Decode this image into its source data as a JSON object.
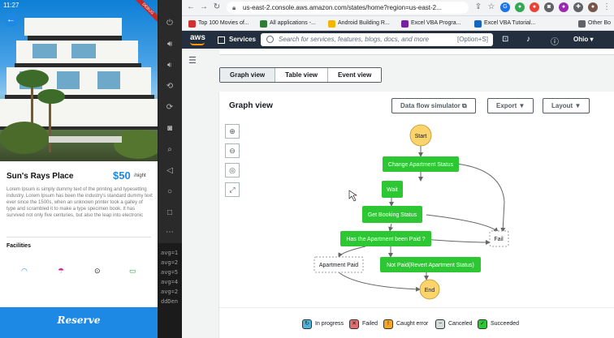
{
  "phone": {
    "status_time": "11:27",
    "debug_ribbon": "DEBUG",
    "place_title": "Sun's Rays Place",
    "price": "$50",
    "per_night": "/night",
    "description": "Lorem Ipsum is simply dummy text of the printing and typesetting industry. Lorem Ipsum has been the industry's standard dummy text ever since the 1500s, when an unknown printer took a galley of type and scrambled it to make a type specimen book. It has survived not only five centuries, but also the leap into electronic",
    "facilities_title": "Facilities",
    "facilities": [
      {
        "icon": "wifi-icon",
        "glyph": "◠",
        "color": "#1e88e5"
      },
      {
        "icon": "umbrella-icon",
        "glyph": "☂",
        "color": "#d81b9a"
      },
      {
        "icon": "bike-icon",
        "glyph": "⊙",
        "color": "#222222"
      },
      {
        "icon": "tv-icon",
        "glyph": "▭",
        "color": "#2e9e4f"
      }
    ],
    "reserve_label": "Reserve"
  },
  "console_lines": [
    "avg=1",
    "avg=2",
    "avg=5",
    "avg=4",
    "avg=2",
    "ddDen"
  ],
  "browser": {
    "url": "us-east-2.console.aws.amazon.com/states/home?region=us-east-2...",
    "bookmarks": [
      {
        "label": "Top 100 Movies of...",
        "color": "#d32f2f"
      },
      {
        "label": "All applications -...",
        "color": "#2e7d32"
      },
      {
        "label": "Android Building R...",
        "color": "#f4b400"
      },
      {
        "label": "Excel VBA Progra...",
        "color": "#7b1fa2"
      },
      {
        "label": "Excel VBA Tutorial...",
        "color": "#1565c0"
      }
    ],
    "other_bookmarks": "Other Bo"
  },
  "aws": {
    "logo": "aws",
    "services_label": "Services",
    "search_placeholder": "Search for services, features, blogs, docs, and more",
    "search_hint": "[Option+S]",
    "region": "Ohio ▾"
  },
  "view_tabs": [
    "Graph view",
    "Table view",
    "Event view"
  ],
  "panel": {
    "title": "Graph view",
    "data_flow_btn": "Data flow simulator ⧉",
    "export_btn": "Export ▼",
    "layout_btn": "Layout ▼"
  },
  "zoom_controls": [
    "⊕",
    "⊖",
    "◎",
    "⤢"
  ],
  "graph": {
    "nodes": {
      "start": "Start",
      "change_status": "Change Apartment Status",
      "wait": "Wait",
      "get_booking": "Get Booking Status",
      "is_paid": "Has the Apartment been Paid ?",
      "fail": "Fail",
      "apt_paid": "Apartment Paid",
      "not_paid": "Not Paid(Revert Apartment Status)",
      "end": "End"
    },
    "colors": {
      "succeeded": "#2dc733",
      "pseudo": "#fdd36b",
      "edge": "#666666"
    }
  },
  "legend": [
    {
      "label": "In progress",
      "color": "#4fb3d9",
      "glyph": "↻"
    },
    {
      "label": "Failed",
      "color": "#e07070",
      "glyph": "✕"
    },
    {
      "label": "Caught error",
      "color": "#f5a623",
      "glyph": "!"
    },
    {
      "label": "Canceled",
      "color": "#d5dbdb",
      "glyph": "−"
    },
    {
      "label": "Succeeded",
      "color": "#2dc733",
      "glyph": "✓"
    }
  ]
}
